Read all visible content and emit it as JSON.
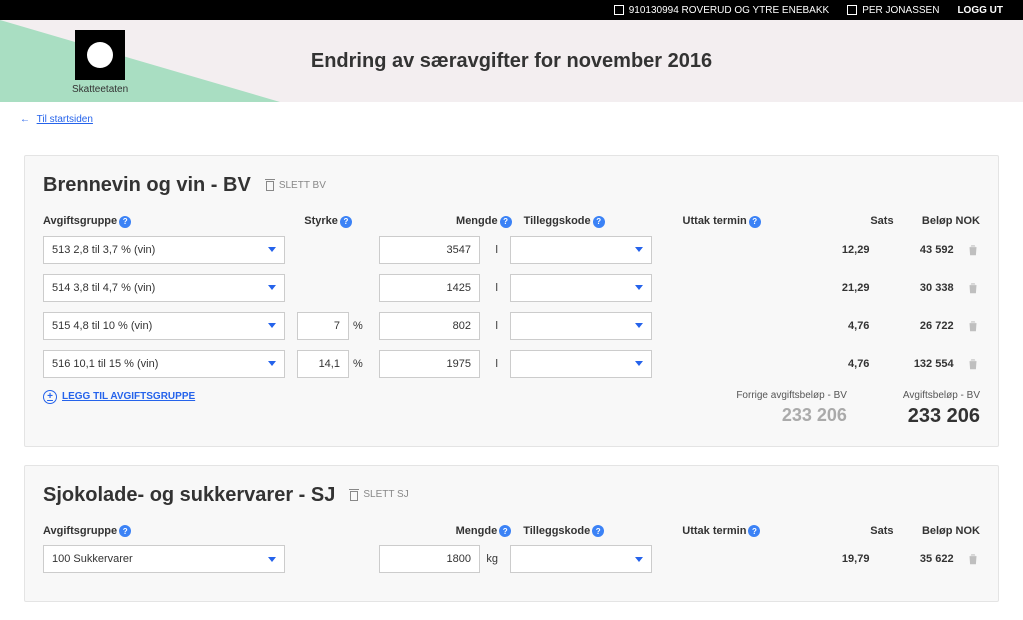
{
  "topbar": {
    "org": "910130994 ROVERUD OG YTRE ENEBAKK",
    "user": "PER JONASSEN",
    "logout": "LOGG UT"
  },
  "logo_caption": "Skatteetaten",
  "header_title": "Endring av særavgifter for november 2016",
  "breadcrumb": {
    "back_label": "Til startsiden"
  },
  "section_bv": {
    "title": "Brennevin og vin - BV",
    "delete_label": "SLETT BV",
    "headers": {
      "avgiftgruppe": "Avgiftsgruppe",
      "styrke": "Styrke",
      "mengde": "Mengde",
      "tilleggskode": "Tilleggskode",
      "uttak": "Uttak termin",
      "sats": "Sats",
      "belop": "Beløp NOK"
    },
    "rows": [
      {
        "gruppe": "513 2,8 til 3,7 % (vin)",
        "styrke": "",
        "mengde": "3547",
        "unit": "l",
        "sats": "12,29",
        "belop": "43 592"
      },
      {
        "gruppe": "514 3,8 til 4,7 % (vin)",
        "styrke": "",
        "mengde": "1425",
        "unit": "l",
        "sats": "21,29",
        "belop": "30 338"
      },
      {
        "gruppe": "515 4,8 til 10 % (vin)",
        "styrke": "7",
        "mengde": "802",
        "unit": "l",
        "sats": "4,76",
        "belop": "26 722"
      },
      {
        "gruppe": "516 10,1 til 15 % (vin)",
        "styrke": "14,1",
        "mengde": "1975",
        "unit": "l",
        "sats": "4,76",
        "belop": "132 554"
      }
    ],
    "add_label": "LEGG TIL AVGIFTSGRUPPE",
    "footer": {
      "prev_label": "Forrige avgiftsbeløp - BV",
      "prev_value": "233 206",
      "curr_label": "Avgiftsbeløp - BV",
      "curr_value": "233 206"
    },
    "pct": "%"
  },
  "section_sj": {
    "title": "Sjokolade- og sukkervarer - SJ",
    "delete_label": "SLETT SJ",
    "headers": {
      "avgiftgruppe": "Avgiftsgruppe",
      "mengde": "Mengde",
      "tilleggskode": "Tilleggskode",
      "uttak": "Uttak termin",
      "sats": "Sats",
      "belop": "Beløp NOK"
    },
    "rows": [
      {
        "gruppe": "100 Sukkervarer",
        "mengde": "1800",
        "unit": "kg",
        "sats": "19,79",
        "belop": "35 622"
      }
    ]
  }
}
